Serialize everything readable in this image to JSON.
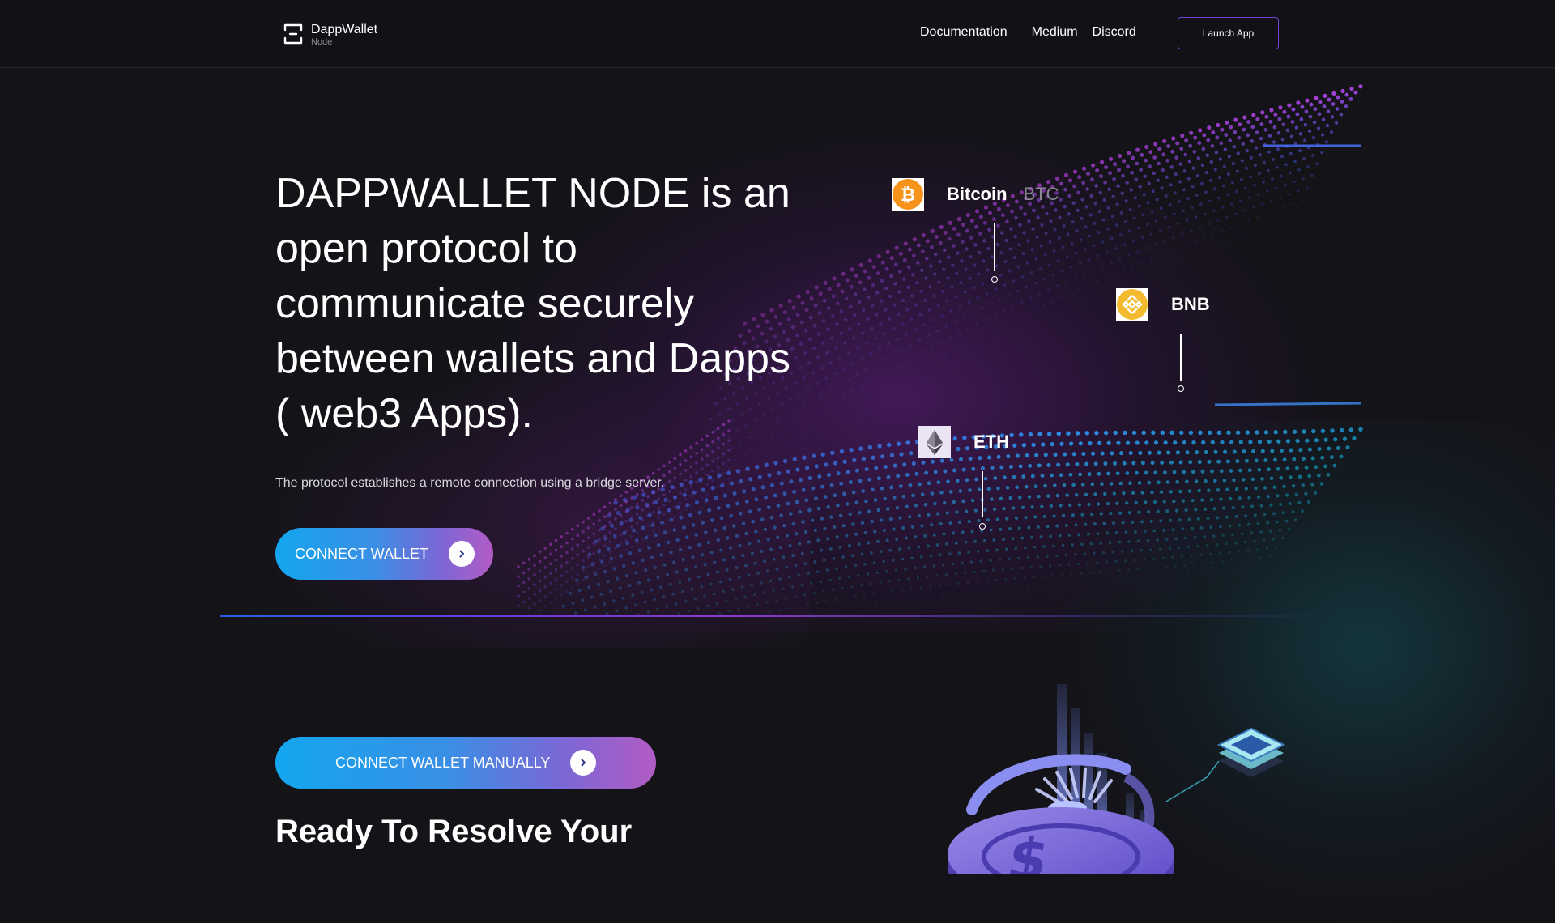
{
  "header": {
    "logo_title": "DappWallet",
    "logo_sub": "Node",
    "nav": [
      "Documentation",
      "Medium",
      "Discord"
    ],
    "launch_label": "Launch App"
  },
  "hero": {
    "title": "DAPPWALLET NODE is an open protocol to communicate securely between wallets and Dapps ( web3 Apps).",
    "subtitle": "The protocol establishes a remote connection using a bridge server.",
    "connect_label": "CONNECT WALLET"
  },
  "coins": [
    {
      "name": "Bitcoin",
      "ticker": "BTC",
      "icon": "bitcoin-icon",
      "color": "#f7931a"
    },
    {
      "name": "BNB",
      "ticker": "",
      "icon": "bnb-icon",
      "color": "#f3ba2f"
    },
    {
      "name": "ETH",
      "ticker": "",
      "icon": "ethereum-icon",
      "color": "#ebe4f5"
    }
  ],
  "section2": {
    "manual_label": "CONNECT WALLET MANUALLY",
    "title": "Ready To Resolve Your"
  },
  "colors": {
    "accent_blue": "#13a6ee",
    "accent_purple": "#b35bc4",
    "border_purple": "#6f45d6",
    "background": "#141318"
  }
}
